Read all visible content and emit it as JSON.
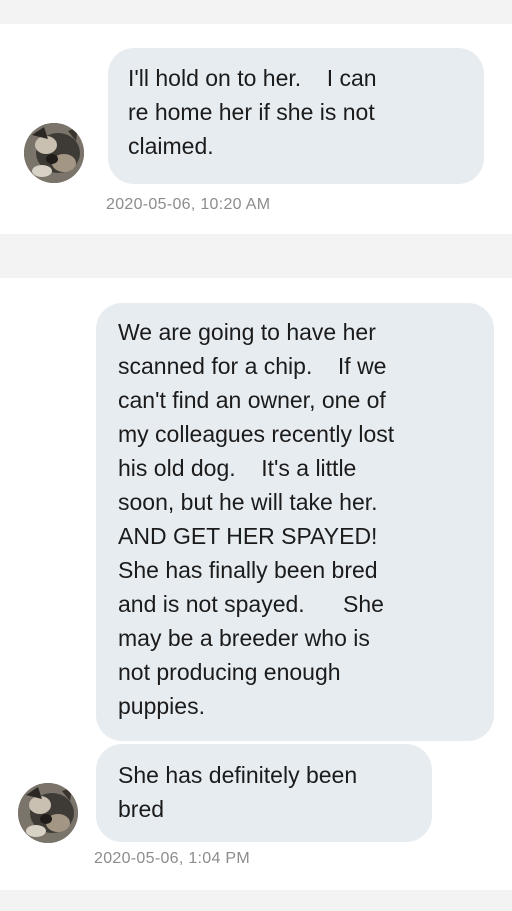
{
  "messages": [
    {
      "text": "I'll hold on to her.    I can\nre home her if she is not\nclaimed.",
      "timestamp": "2020-05-06, 10:20 AM"
    },
    {
      "text": "We are going to have her\nscanned for a chip.    If we\ncan't find an owner, one of\nmy colleagues recently lost\nhis old dog.    It's a little\nsoon, but he will take her.\nAND GET HER SPAYED!\nShe has finally been bred\nand is not spayed.      She\nmay be a breeder who is\nnot producing enough\npuppies."
    },
    {
      "text": "She has definitely been\nbred",
      "timestamp": "2020-05-06, 1:04 PM"
    }
  ],
  "avatar_icon": "dog-photo-avatar",
  "colors": {
    "bubble": "#e7ecf1",
    "background": "#f3f3f3",
    "timestamp": "#8c8c8c"
  }
}
